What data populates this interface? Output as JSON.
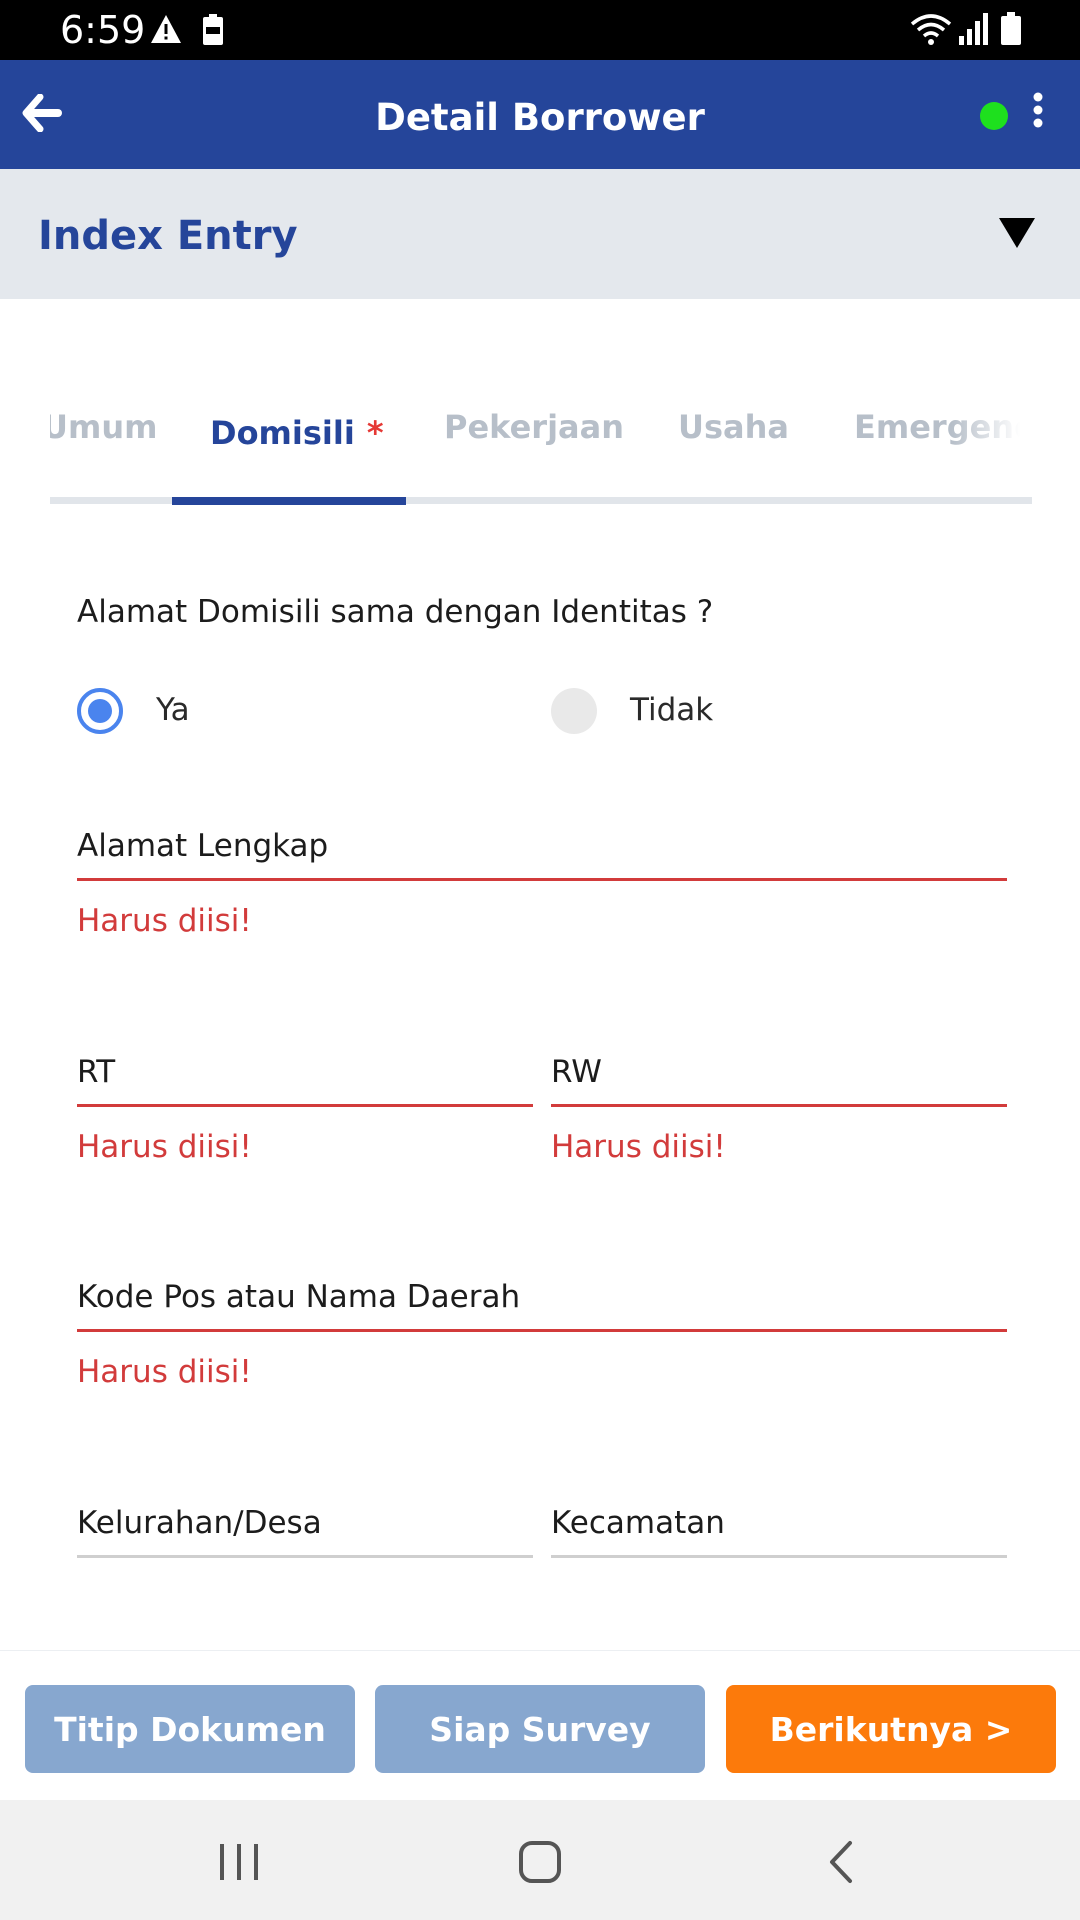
{
  "status_bar": {
    "time": "6:59",
    "icons": [
      "warning-icon",
      "battery-saver-icon",
      "wifi-icon",
      "signal-icon",
      "battery-icon"
    ]
  },
  "app_bar": {
    "title": "Detail Borrower",
    "back_icon": "arrow-left-icon",
    "status_color": "#1ee01e",
    "menu_icon": "more-vertical-icon",
    "background": "#25459a"
  },
  "index_entry": {
    "label": "Index Entry",
    "toggle_icon": "caret-down-icon"
  },
  "tabs": [
    {
      "label": "Umum",
      "active": false
    },
    {
      "label": "Domisili",
      "active": true,
      "required_mark": "*"
    },
    {
      "label": "Pekerjaan",
      "active": false
    },
    {
      "label": "Usaha",
      "active": false
    },
    {
      "label": "Emergency",
      "active": false
    }
  ],
  "form": {
    "question": "Alamat Domisili sama dengan Identitas ?",
    "options": [
      {
        "label": "Ya",
        "selected": true
      },
      {
        "label": "Tidak",
        "selected": false
      }
    ],
    "fields": {
      "alamat": {
        "label": "Alamat Lengkap",
        "error": "Harus diisi!"
      },
      "rt": {
        "label": "RT",
        "error": "Harus diisi!"
      },
      "rw": {
        "label": "RW",
        "error": "Harus diisi!"
      },
      "kodepos": {
        "label": "Kode Pos atau Nama Daerah",
        "error": "Harus diisi!"
      },
      "kelurahan": {
        "label": "Kelurahan/Desa"
      },
      "kecamatan": {
        "label": "Kecamatan"
      }
    },
    "error_color": "#d23b3b"
  },
  "actions": {
    "titip_label": "Titip Dokumen",
    "siap_label": "Siap Survey",
    "next_label": "Berikutnya >",
    "accent": "#fc7a0b"
  },
  "nav_bar": {
    "icons": [
      "recent-apps-icon",
      "home-icon",
      "back-icon"
    ]
  }
}
